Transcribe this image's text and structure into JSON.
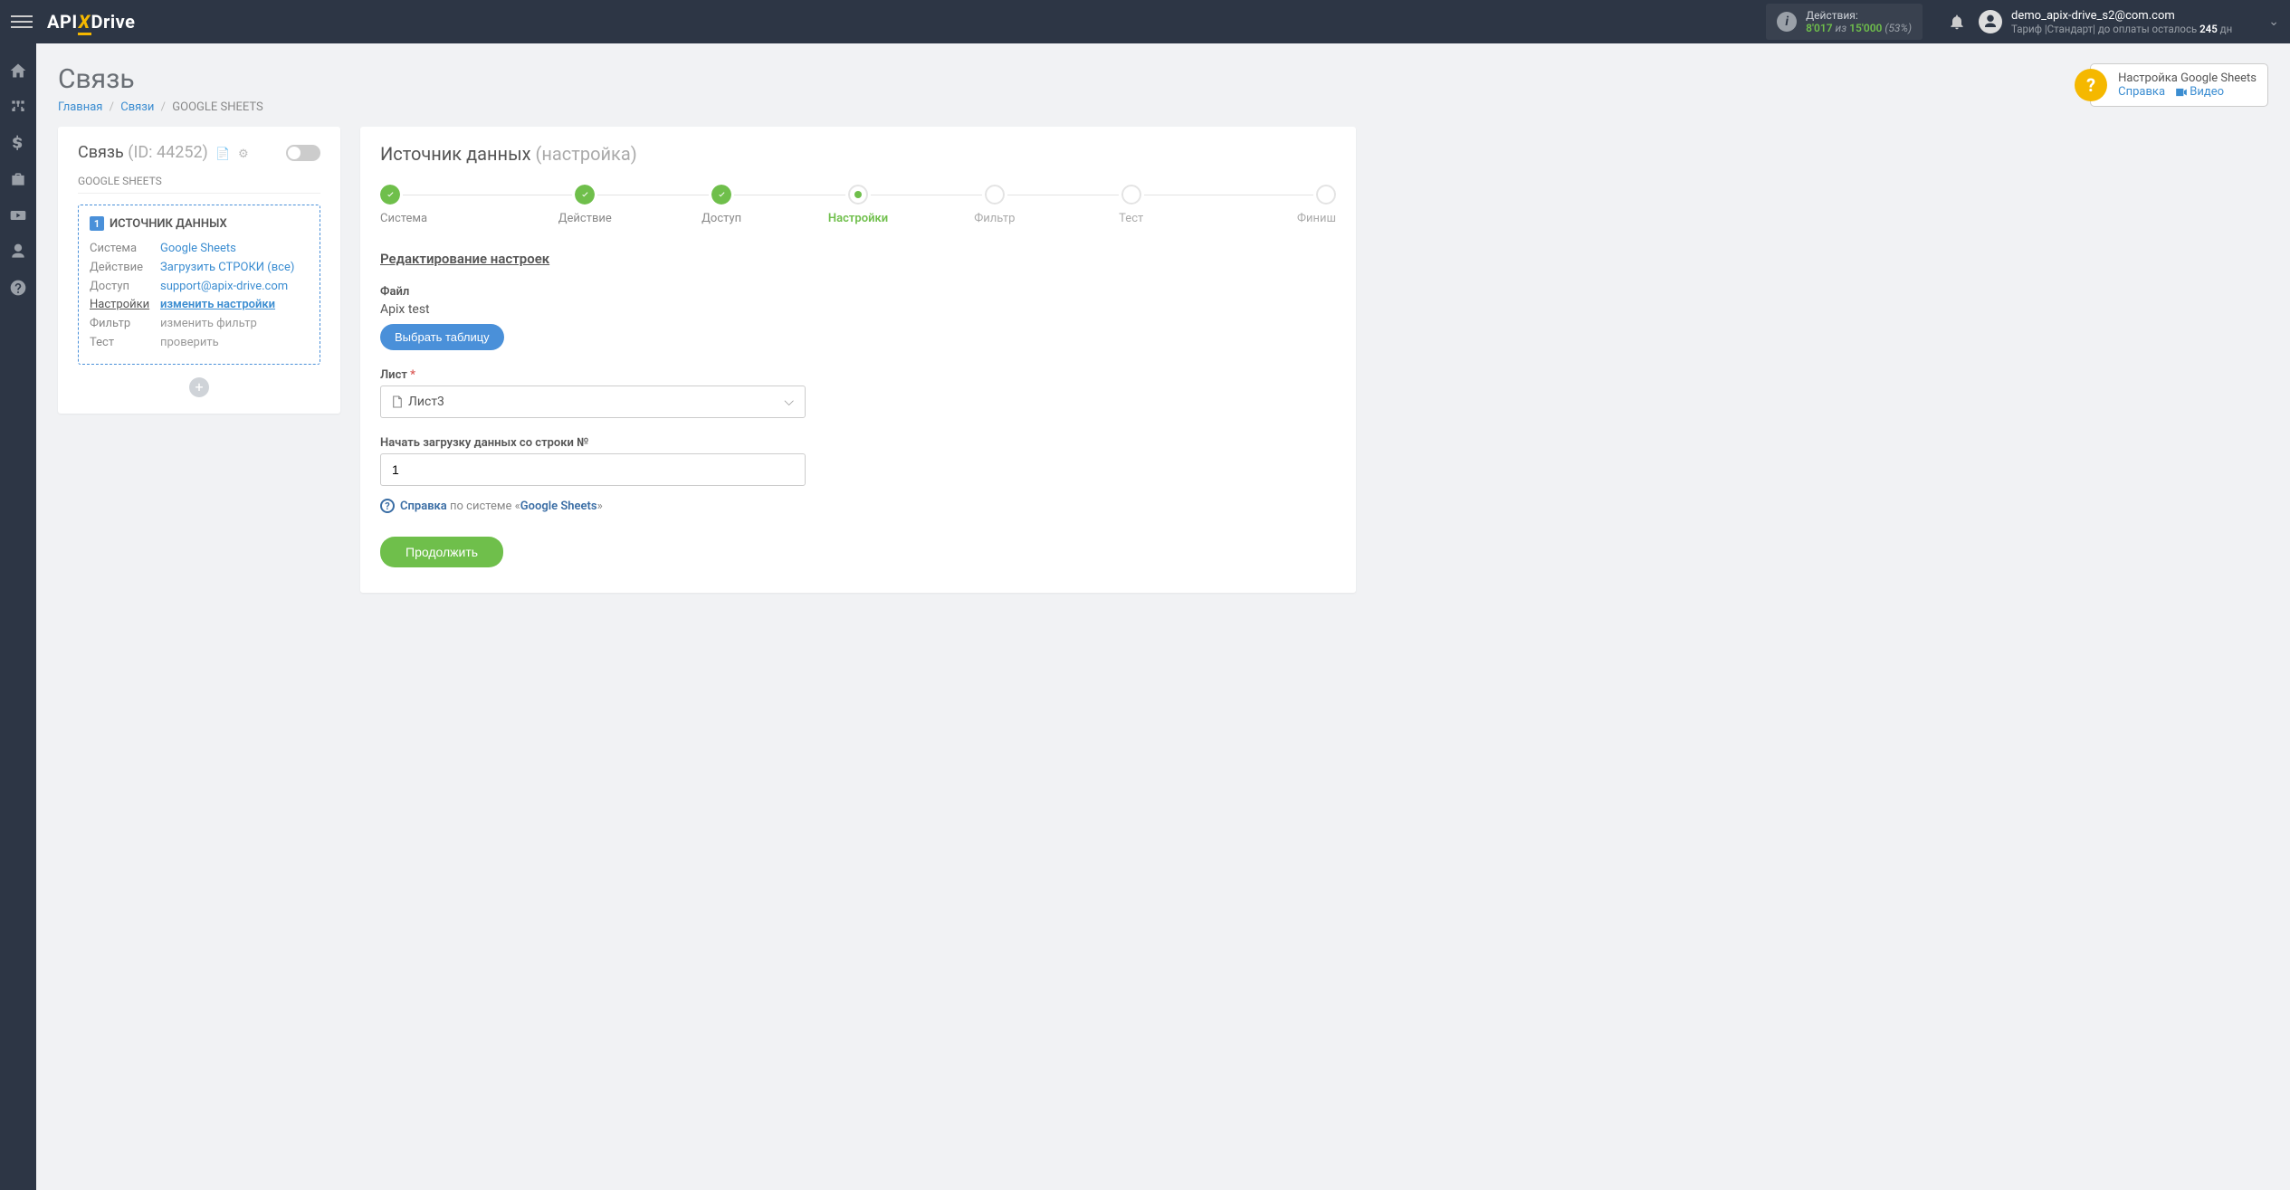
{
  "header": {
    "logo": {
      "p1": "API",
      "p2": "X",
      "p3": "Drive"
    },
    "actions": {
      "label": "Действия:",
      "count": "8'017",
      "of": "из",
      "total": "15'000",
      "pct": "(53%)"
    },
    "user": {
      "email": "demo_apix-drive_s2@com.com",
      "tariff_pre": "Тариф |Стандарт| до оплаты осталось ",
      "days": "245",
      "tariff_post": " дн"
    }
  },
  "page": {
    "title": "Связь",
    "crumbs": {
      "home": "Главная",
      "links": "Связи",
      "current": "GOOGLE SHEETS"
    },
    "help": {
      "title": "Настройка Google Sheets",
      "ref": "Справка",
      "video": "Видео"
    }
  },
  "side": {
    "title": "Связь",
    "id": "(ID: 44252)",
    "sub": "GOOGLE SHEETS",
    "box_title": "ИСТОЧНИК ДАННЫХ",
    "rows": [
      {
        "k": "Система",
        "v": "Google Sheets",
        "cls": ""
      },
      {
        "k": "Действие",
        "v": "Загрузить СТРОКИ (все)",
        "cls": ""
      },
      {
        "k": "Доступ",
        "v": "support@apix-drive.com",
        "cls": ""
      },
      {
        "k": "Настройки",
        "v": "изменить настройки",
        "cls": "active"
      },
      {
        "k": "Фильтр",
        "v": "изменить фильтр",
        "cls": "muted"
      },
      {
        "k": "Тест",
        "v": "проверить",
        "cls": "muted"
      }
    ]
  },
  "main_card": {
    "title": "Источник данных",
    "sub": "(настройка)",
    "steps": [
      {
        "label": "Система",
        "state": "done"
      },
      {
        "label": "Действие",
        "state": "done"
      },
      {
        "label": "Доступ",
        "state": "done"
      },
      {
        "label": "Настройки",
        "state": "current"
      },
      {
        "label": "Фильтр",
        "state": "pending"
      },
      {
        "label": "Тест",
        "state": "pending"
      },
      {
        "label": "Финиш",
        "state": "pending"
      }
    ],
    "section": "Редактирование настроек",
    "file": {
      "label": "Файл",
      "value": "Apix test",
      "btn": "Выбрать таблицу"
    },
    "sheet": {
      "label": "Лист",
      "value": "Лист3"
    },
    "row": {
      "label": "Начать загрузку данных со строки №",
      "value": "1"
    },
    "help": {
      "link": "Справка",
      "rest": " по системе «",
      "sys": "Google Sheets",
      "end": "»"
    },
    "submit": "Продолжить"
  }
}
